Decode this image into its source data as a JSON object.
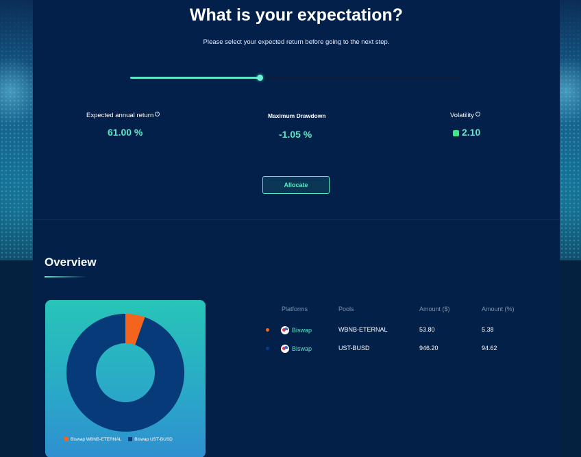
{
  "expectation": {
    "title": "What is your expectation?",
    "subtitle": "Please select your expected return before going to the next step.",
    "slider_fraction": 0.39
  },
  "metrics": {
    "expected_return": {
      "label": "Expected annual return",
      "value": "61.00 %"
    },
    "max_drawdown": {
      "label": "Maximum Drawdown",
      "value": "-1.05 %"
    },
    "volatility": {
      "label": "Volatility",
      "value": "2.10"
    },
    "info_glyph": "i"
  },
  "allocate_button": "Allocate",
  "overview": {
    "title": "Overview",
    "pie": {
      "slices": [
        {
          "label": "Biswap WBNB-ETERNAL",
          "percent": 5.38,
          "color": "#f4641c"
        },
        {
          "label": "Biswap UST-BUSD",
          "percent": 94.62,
          "color": "#063a78"
        }
      ]
    },
    "table": {
      "headers": [
        "Platforms",
        "Pools",
        "Amount ($)",
        "Amount (%)"
      ],
      "rows": [
        {
          "dot_color": "#f4641c",
          "platform": "Biswap",
          "pool": "WBNB-ETERNAL",
          "amount_usd": "53.80",
          "amount_pct": "5.38"
        },
        {
          "dot_color": "#0a3a8a",
          "platform": "Biswap",
          "pool": "UST-BUSD",
          "amount_usd": "946.20",
          "amount_pct": "94.62"
        }
      ]
    }
  },
  "colors": {
    "accent": "#5ee6c8",
    "volatility_indicator": "#3ee88a"
  }
}
